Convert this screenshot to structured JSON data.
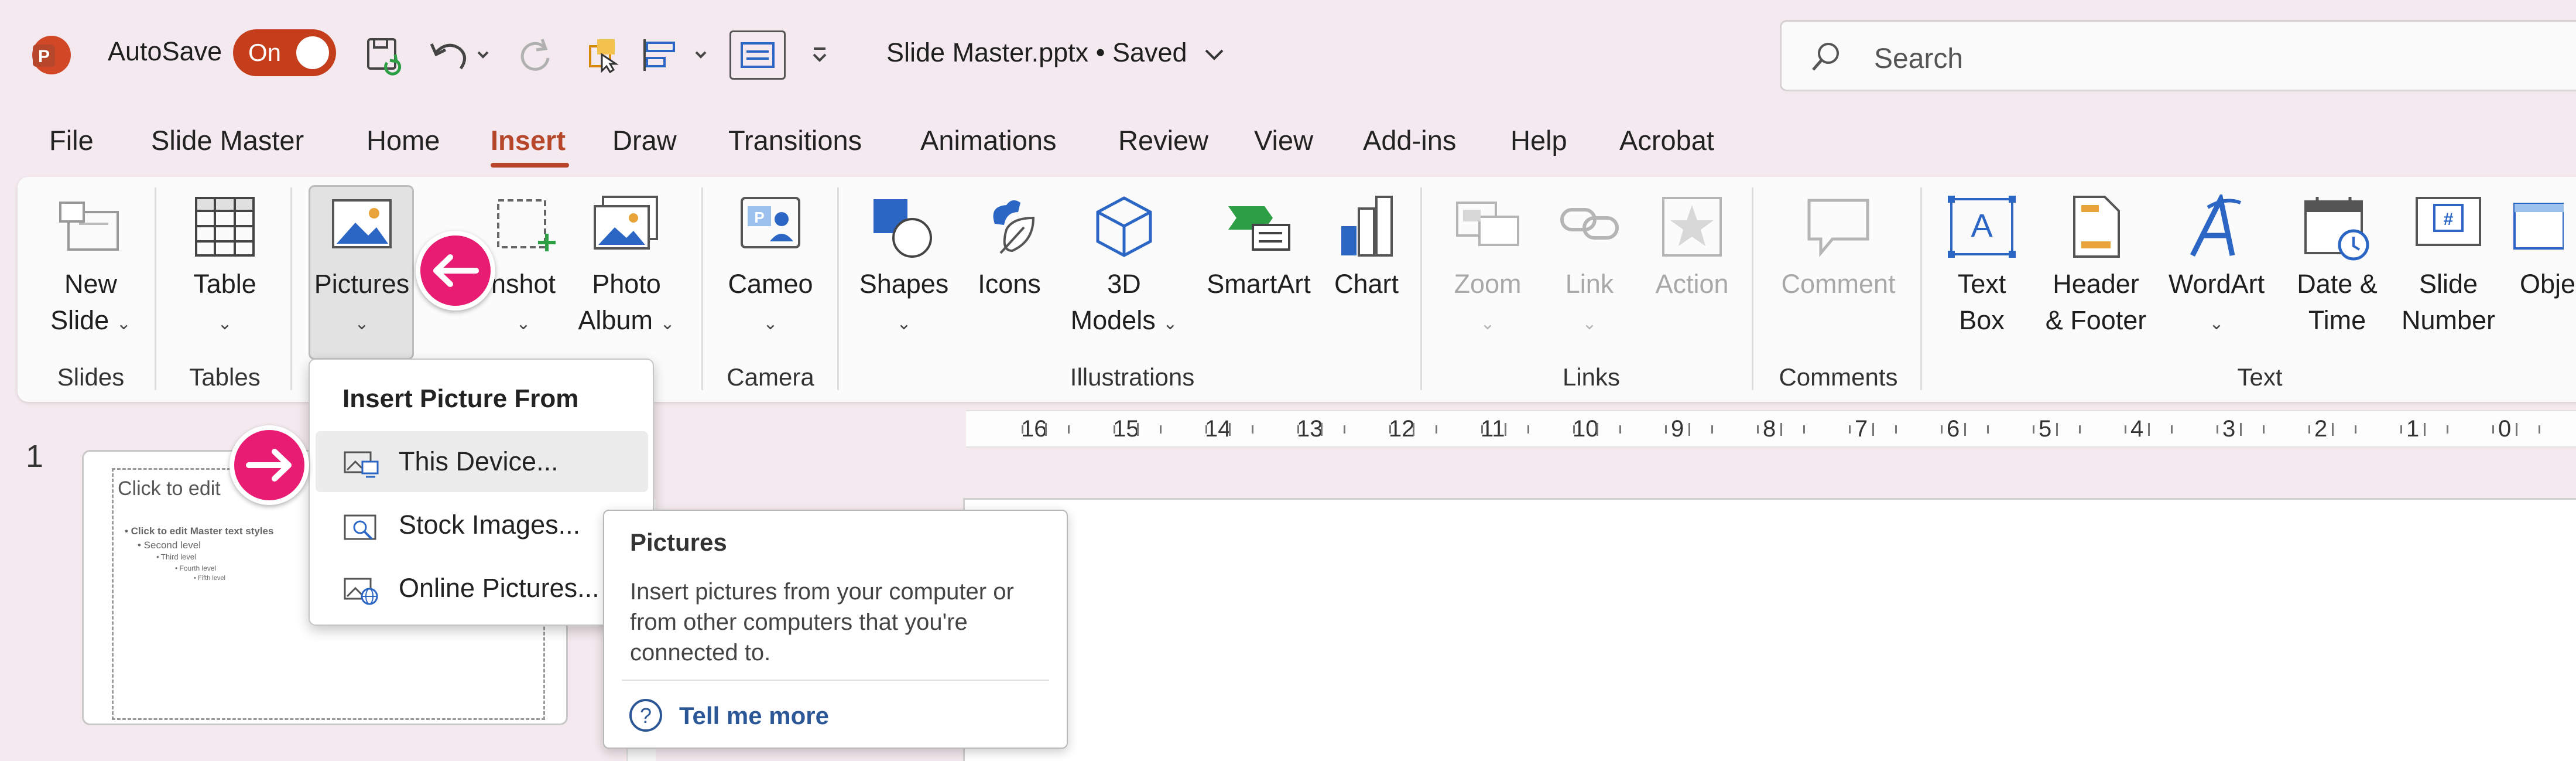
{
  "titlebar": {
    "autosave_label": "AutoSave",
    "autosave_state": "On",
    "filename": "Slide Master.pptx",
    "status": "Saved",
    "search_placeholder": "Search",
    "accent_color": "#c43e1c"
  },
  "tabs": [
    {
      "label": "File",
      "active": false
    },
    {
      "label": "Slide Master",
      "active": false
    },
    {
      "label": "Home",
      "active": false
    },
    {
      "label": "Insert",
      "active": true
    },
    {
      "label": "Draw",
      "active": false
    },
    {
      "label": "Transitions",
      "active": false
    },
    {
      "label": "Animations",
      "active": false
    },
    {
      "label": "Review",
      "active": false
    },
    {
      "label": "View",
      "active": false
    },
    {
      "label": "Add-ins",
      "active": false
    },
    {
      "label": "Help",
      "active": false
    },
    {
      "label": "Acrobat",
      "active": false
    }
  ],
  "ribbon": {
    "buttons": {
      "new_slide": {
        "line1": "New",
        "line2": "Slide"
      },
      "table": {
        "line1": "Table"
      },
      "pictures": {
        "line1": "Pictures"
      },
      "screenshot": {
        "line1": "nshot"
      },
      "photo_album": {
        "line1": "Photo",
        "line2": "Album"
      },
      "cameo": {
        "line1": "Cameo"
      },
      "shapes": {
        "line1": "Shapes"
      },
      "icons": {
        "line1": "Icons"
      },
      "models_3d": {
        "line1": "3D",
        "line2": "Models"
      },
      "smartart": {
        "line1": "SmartArt"
      },
      "chart": {
        "line1": "Chart"
      },
      "zoom": {
        "line1": "Zoom"
      },
      "link": {
        "line1": "Link"
      },
      "action": {
        "line1": "Action"
      },
      "comment": {
        "line1": "Comment"
      },
      "text_box": {
        "line1": "Text",
        "line2": "Box"
      },
      "header_footer": {
        "line1": "Header",
        "line2": "& Footer"
      },
      "wordart": {
        "line1": "WordArt"
      },
      "date_time": {
        "line1": "Date &",
        "line2": "Time"
      },
      "slide_number": {
        "line1": "Slide",
        "line2": "Number"
      },
      "object": {
        "line1": "Object"
      }
    },
    "groups": {
      "slides": "Slides",
      "tables": "Tables",
      "camera": "Camera",
      "illustrations": "Illustrations",
      "links": "Links",
      "comments": "Comments",
      "text": "Text"
    }
  },
  "ruler": {
    "labels": [
      "16",
      "15",
      "14",
      "13",
      "12",
      "11",
      "10",
      "9",
      "8",
      "7",
      "6",
      "5",
      "4",
      "3",
      "2",
      "1",
      "0"
    ]
  },
  "slides_panel": {
    "slide_number": "1",
    "thumb_title": "Click to edit",
    "thumb_lines": [
      "• Click to edit Master text styles",
      "• Second level",
      "• Third level",
      "• Fourth level",
      "• Fifth level"
    ]
  },
  "dropdown": {
    "header": "Insert Picture From",
    "items": [
      {
        "label": "This Device...",
        "icon": "device-picture-icon"
      },
      {
        "label": "Stock Images...",
        "icon": "stock-images-icon"
      },
      {
        "label": "Online Pictures...",
        "icon": "online-pictures-icon"
      }
    ]
  },
  "tooltip": {
    "title": "Pictures",
    "body": "Insert pictures from your computer or from other computers that you're connected to.",
    "link": "Tell me more"
  },
  "annotations": {
    "color": "#e81c73"
  }
}
